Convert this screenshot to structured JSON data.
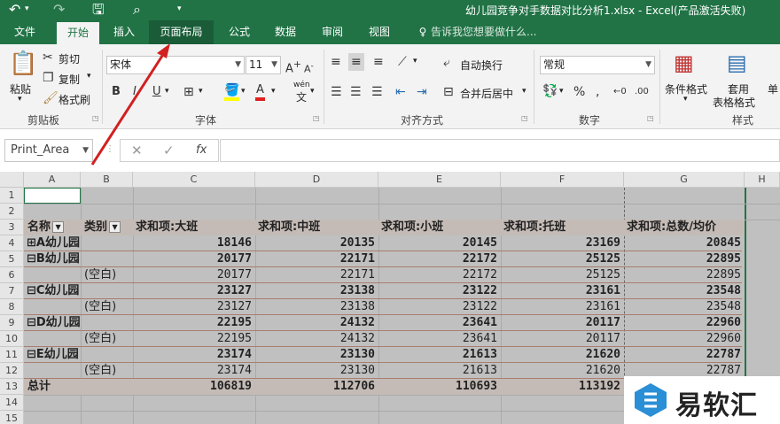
{
  "window": {
    "title": "幼儿园竞争对手数据对比分析1.xlsx - Excel(产品激活失败)"
  },
  "tabs": [
    {
      "label": "文件"
    },
    {
      "label": "开始"
    },
    {
      "label": "插入"
    },
    {
      "label": "页面布局"
    },
    {
      "label": "公式"
    },
    {
      "label": "数据"
    },
    {
      "label": "审阅"
    },
    {
      "label": "视图"
    }
  ],
  "tell_me": "告诉我您想要做什么...",
  "ribbon": {
    "clipboard": {
      "paste": "粘贴",
      "cut": "剪切",
      "copy": "复制",
      "format_painter": "格式刷",
      "label": "剪贴板"
    },
    "font": {
      "name": "宋体",
      "size": "11",
      "bold": "B",
      "italic": "I",
      "underline": "U",
      "label": "字体",
      "wen": "wén"
    },
    "align": {
      "wrap": "自动换行",
      "merge": "合并后居中",
      "label": "对齐方式"
    },
    "number": {
      "format": "常规",
      "label": "数字"
    },
    "styles": {
      "cond": "条件格式",
      "table1": "套用",
      "table2": "表格格式",
      "cell": "单",
      "label": "样式"
    }
  },
  "name_box": "Print_Area",
  "fx": "fx",
  "columns": [
    "A",
    "B",
    "C",
    "D",
    "E",
    "F",
    "G",
    "H"
  ],
  "rows": [
    "1",
    "2",
    "3",
    "4",
    "5",
    "6",
    "7",
    "8",
    "9",
    "10",
    "11",
    "12",
    "13",
    "14",
    "15"
  ],
  "pivot": {
    "header": {
      "name": "名称",
      "type": "类别",
      "c": "求和项:大班",
      "d": "求和项:中班",
      "e": "求和项:小班",
      "f": "求和项:托班",
      "g": "求和项:总数/均价"
    },
    "body": [
      {
        "a": "⊞A幼儿园",
        "b": "",
        "c": "18146",
        "d": "20135",
        "e": "20145",
        "f": "23169",
        "g": "20845",
        "bold": true
      },
      {
        "a": "⊟B幼儿园",
        "b": "",
        "c": "20177",
        "d": "22171",
        "e": "22172",
        "f": "25125",
        "g": "22895",
        "bold": true
      },
      {
        "a": "",
        "b": "(空白)",
        "c": "20177",
        "d": "22171",
        "e": "22172",
        "f": "25125",
        "g": "22895",
        "bold": false
      },
      {
        "a": "⊟C幼儿园",
        "b": "",
        "c": "23127",
        "d": "23138",
        "e": "23122",
        "f": "23161",
        "g": "23548",
        "bold": true
      },
      {
        "a": "",
        "b": "(空白)",
        "c": "23127",
        "d": "23138",
        "e": "23122",
        "f": "23161",
        "g": "23548",
        "bold": false
      },
      {
        "a": "⊟D幼儿园",
        "b": "",
        "c": "22195",
        "d": "24132",
        "e": "23641",
        "f": "20117",
        "g": "22960",
        "bold": true
      },
      {
        "a": "",
        "b": "(空白)",
        "c": "22195",
        "d": "24132",
        "e": "23641",
        "f": "20117",
        "g": "22960",
        "bold": false
      },
      {
        "a": "⊟E幼儿园",
        "b": "",
        "c": "23174",
        "d": "23130",
        "e": "21613",
        "f": "21620",
        "g": "22787",
        "bold": true
      },
      {
        "a": "",
        "b": "(空白)",
        "c": "23174",
        "d": "23130",
        "e": "21613",
        "f": "21620",
        "g": "22787",
        "bold": false
      }
    ],
    "total": {
      "a": "总计",
      "c": "106819",
      "d": "112706",
      "e": "110693",
      "f": "113192"
    }
  },
  "watermark": "易软汇",
  "colors": {
    "excel_green": "#217346",
    "pivot_header": "#c4bbb6",
    "arrow": "#d22020"
  }
}
